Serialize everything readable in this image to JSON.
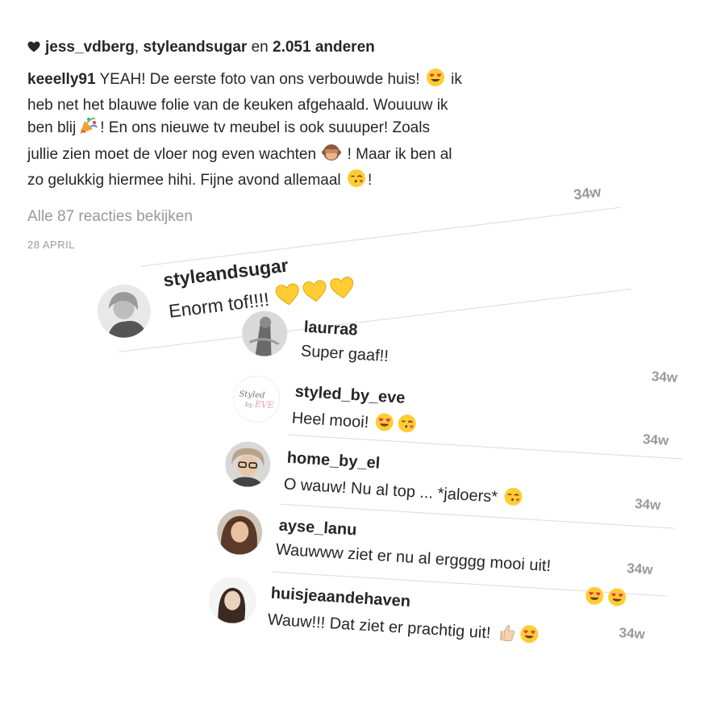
{
  "post": {
    "likes": {
      "user1": "jess_vdberg",
      "sep": ",",
      "user2": "styleandsugar",
      "and": "en",
      "count": "2.051 anderen"
    },
    "caption": {
      "username": "keeelly91",
      "p1": "YEAH! De eerste foto van ons verbouwde huis!",
      "p2": "ik heb net het blauwe folie van de keuken afgehaald. Wouuuw ik ben blij",
      "p3": "! En ons nieuwe tv meubel is ook suuuper! Zoals jullie zien moet de vloer nog even wachten",
      "p4": "! Maar ik ben al zo gelukkig hiermee hihi. Fijne avond allemaal",
      "p5": "!"
    },
    "view_all": "Alle 87 reacties bekijken",
    "date": "28 APRIL",
    "caption_time": "34w"
  },
  "comments": [
    {
      "username": "styleandsugar",
      "text": "Enorm tof!!!!"
    },
    {
      "username": "laurra8",
      "text": "Super gaaf!!",
      "time": "34w"
    },
    {
      "username": "styled_by_eve",
      "text": "Heel mooi!",
      "time": "34w",
      "avatar_text": "Styled by EVE"
    },
    {
      "username": "home_by_el",
      "text": "O wauw! Nu al top ... *jaloers*",
      "time": "34w"
    },
    {
      "username": "ayse_lanu",
      "text": "Wauwww ziet er nu al ergggg mooi uit!",
      "time": "34w"
    },
    {
      "username": "huisjeaandehaven",
      "text": "Wauw!!! Dat ziet er prachtig uit!",
      "time": "34w"
    }
  ],
  "colors": {
    "text": "#262626",
    "secondary": "#999999",
    "divider": "#dbdbdb",
    "emoji_yellow": "#ffcc33",
    "emoji_heart": "#e8364a"
  }
}
